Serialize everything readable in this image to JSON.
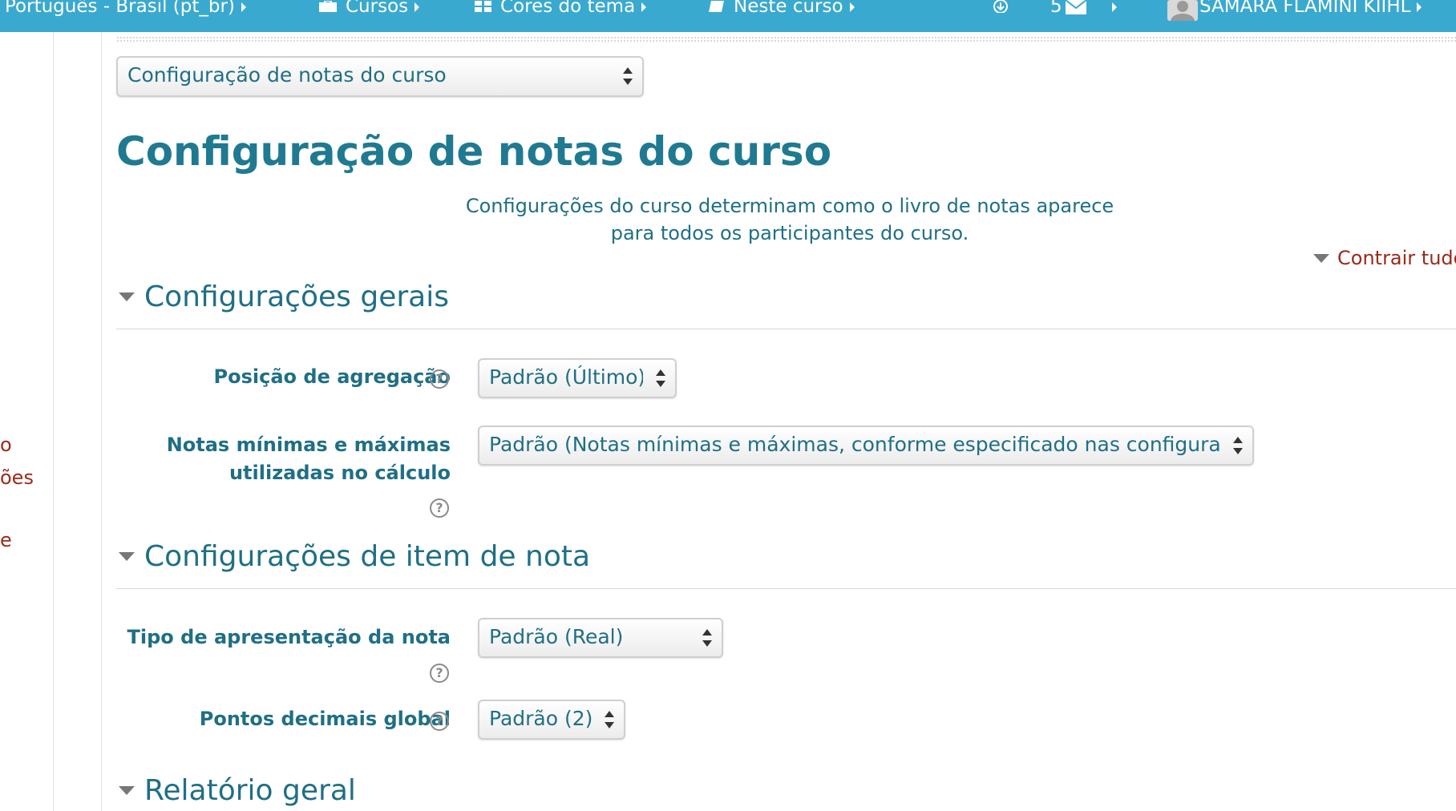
{
  "navbar": {
    "language": "Português - Brasil (pt_br)",
    "courses": "Cursos",
    "theme_colors": "Cores do tema",
    "this_course": "Neste curso",
    "message_count": "5",
    "user_name": "SAMARA FLAMINI KIIHL"
  },
  "left_fragments": [
    "o",
    "ões",
    "e"
  ],
  "page_selector": {
    "value": "Configuração de notas do curso"
  },
  "page_title": "Configuração de notas do curso",
  "intro": {
    "line1": "Configurações do curso determinam como o livro de notas aparece",
    "line2": "para todos os participantes do curso."
  },
  "collapse_all": "Contrair tudo",
  "sections": {
    "general": {
      "title": "Configurações gerais",
      "aggregation_position": {
        "label": "Posição de agregação",
        "value": "Padrão (Último)"
      },
      "minmax": {
        "label_line1": "Notas mínimas e máximas",
        "label_line2": "utilizadas no cálculo",
        "value": "Padrão (Notas mínimas e máximas, conforme especificado nas configurações"
      }
    },
    "grade_item": {
      "title": "Configurações de item de nota",
      "display_type": {
        "label": "Tipo de apresentação da nota",
        "value": "Padrão (Real)"
      },
      "decimal_points": {
        "label": "Pontos decimais global",
        "value": "Padrão (2)"
      }
    },
    "overview": {
      "title": "Relatório geral"
    }
  },
  "help_glyph": "?",
  "colors": {
    "navbar": "#3aa9cf",
    "heading": "#1f7a91",
    "text": "#1f6f86",
    "link": "#9a2a1a"
  }
}
